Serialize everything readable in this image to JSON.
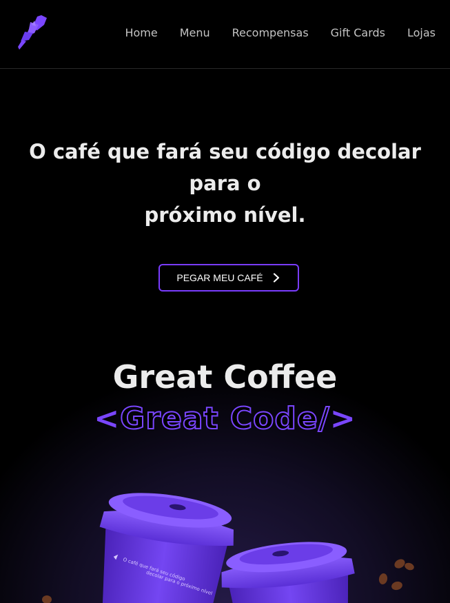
{
  "nav": {
    "items": [
      "Home",
      "Menu",
      "Recompensas",
      "Gift Cards",
      "Lojas"
    ]
  },
  "hero": {
    "headline_line1": "O café que fará seu código decolar para o",
    "headline_line2": "próximo nível.",
    "cta_label": "PEGAR MEU CAFÉ"
  },
  "tagline": {
    "line1": "Great Coffee",
    "open_bracket": "<",
    "code_text": "Great Code/",
    "close_bracket": ">"
  },
  "cup_print": {
    "line1": "O café que fará seu código",
    "line2": "decolar para o próximo nível"
  },
  "colors": {
    "accent": "#7a3cff",
    "background": "#000000",
    "text": "#ececec"
  }
}
